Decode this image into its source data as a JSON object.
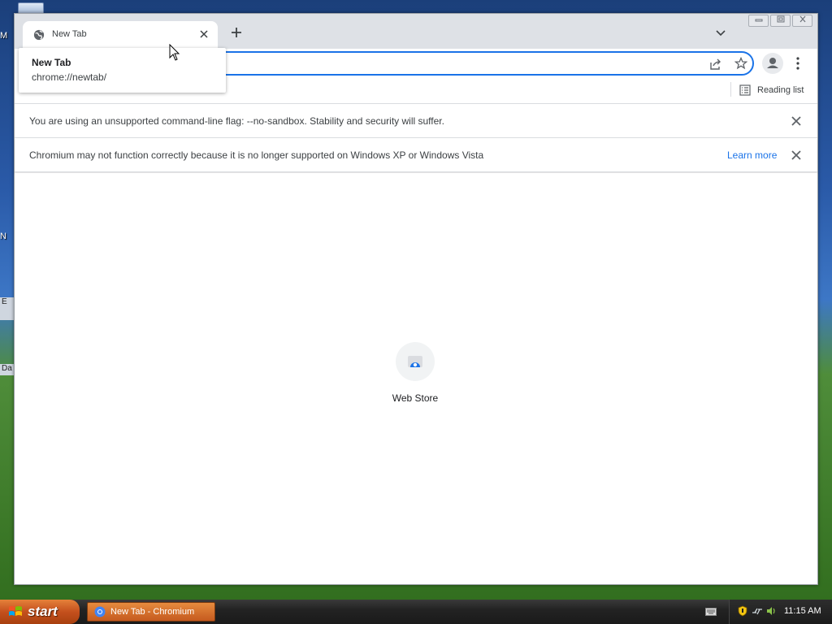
{
  "desktop": {
    "fragments": [
      "M",
      "N",
      "E",
      "Da"
    ]
  },
  "browser": {
    "tab": {
      "title": "New Tab",
      "favicon_icon": "globe-icon",
      "close_icon": "close-icon"
    },
    "new_tab_icon": "plus-icon",
    "tab_search_icon": "chevron-down-icon",
    "window_controls": {
      "minimize_icon": "minimize-icon",
      "restore_icon": "restore-icon",
      "close_icon": "close-icon"
    },
    "omnibox": {
      "value": "",
      "share_icon": "share-icon",
      "bookmark_icon": "star-icon"
    },
    "profile_icon": "person-icon",
    "menu_icon": "kebab-menu-icon",
    "bookmarks_bar": {
      "reading_list_label": "Reading list",
      "reading_list_icon": "reading-list-icon"
    },
    "infobars": [
      {
        "text": "You are using an unsupported command-line flag: --no-sandbox. Stability and security will suffer.",
        "link": "",
        "close_icon": "close-icon"
      },
      {
        "text": "Chromium may not function correctly because it is no longer supported on Windows XP or Windows Vista",
        "link": "Learn more",
        "close_icon": "close-icon"
      }
    ],
    "new_tab_page": {
      "shortcut_label": "Web Store",
      "shortcut_icon": "web-store-icon"
    },
    "hovercard": {
      "title": "New Tab",
      "url": "chrome://newtab/"
    }
  },
  "taskbar": {
    "start_label": "start",
    "task_item_label": "New Tab - Chromium",
    "clock": "11:15 AM",
    "tray_icons": [
      "keyboard-icon",
      "security-shield-icon",
      "network-icon",
      "speaker-icon"
    ]
  },
  "colors": {
    "accent": "#1a73e8",
    "tab_strip": "#dee1e6",
    "start_button": "#c4501d"
  }
}
